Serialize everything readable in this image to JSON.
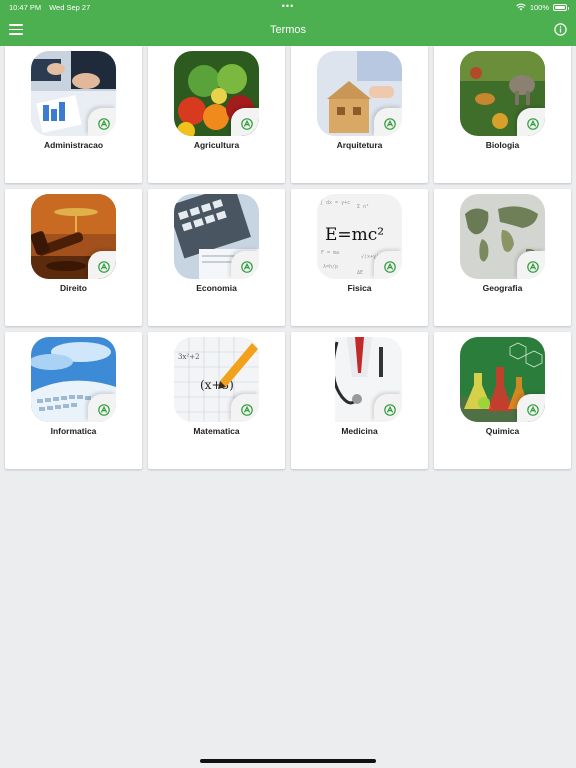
{
  "status": {
    "time": "10:47 PM",
    "date": "Wed Sep 27",
    "dots": "•••",
    "battery": "100%"
  },
  "appbar": {
    "title": "Termos",
    "menu_icon": "hamburger-menu-icon",
    "info_icon": "info-circle-icon"
  },
  "colors": {
    "primary": "#4caf50",
    "badge_green": "#2e9e3a"
  },
  "categories": [
    {
      "label": "Administracao",
      "image": "business-documents"
    },
    {
      "label": "Agricultura",
      "image": "vegetables"
    },
    {
      "label": "Arquitetura",
      "image": "house-model"
    },
    {
      "label": "Biologia",
      "image": "nature-animals"
    },
    {
      "label": "Direito",
      "image": "gavel-scales"
    },
    {
      "label": "Economia",
      "image": "calculator"
    },
    {
      "label": "Fisica",
      "image": "equations"
    },
    {
      "label": "Geografia",
      "image": "world-map"
    },
    {
      "label": "Informatica",
      "image": "keyboard-sky"
    },
    {
      "label": "Matematica",
      "image": "pencil-math"
    },
    {
      "label": "Medicina",
      "image": "stethoscope-coat"
    },
    {
      "label": "Quimica",
      "image": "lab-flasks"
    }
  ]
}
